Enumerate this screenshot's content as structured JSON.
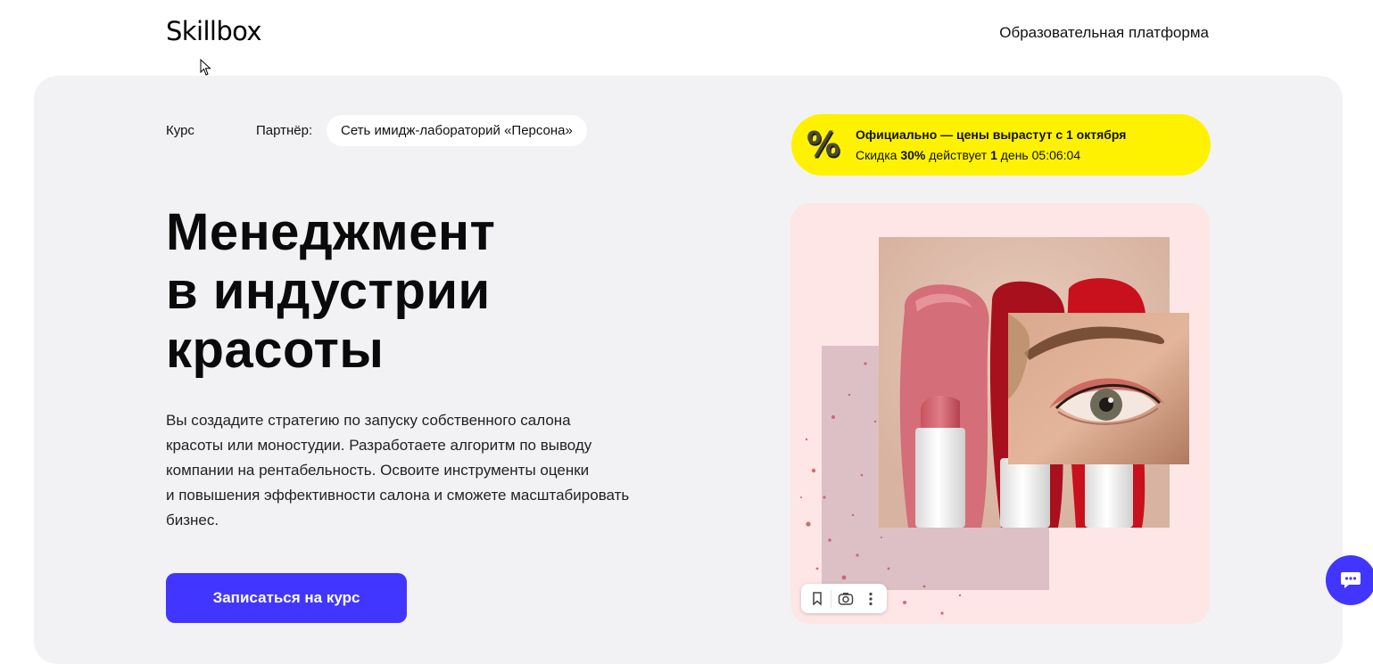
{
  "header": {
    "logo": "Skillbox",
    "tagline": "Образовательная платформа"
  },
  "meta": {
    "type_label": "Курс",
    "partner_label": "Партнёр:",
    "partner_name": "Сеть имидж-лабораторий «Персона»"
  },
  "promo": {
    "icon": "%",
    "line1": "Официально — цены вырастут с 1 октября",
    "line2_prefix": "Скидка",
    "discount": "30%",
    "line2_mid": "действует",
    "days": "1",
    "days_label": "день",
    "timer": "05:06:04",
    "color": "#fff200"
  },
  "course": {
    "title_lines": [
      "Менеджмент",
      "в индустрии",
      "красоты"
    ],
    "description_lines": [
      "Вы создадите стратегию по запуску собственного салона",
      "красоты или моностудии. Разработаете алгоритм по выводу",
      "компании на рентабельность. Освоите инструменты оценки",
      "и повышения эффективности салона и сможете масштабировать",
      "бизнес."
    ],
    "cta_label": "Записаться на курс"
  },
  "visual": {
    "description": "",
    "toolbar_icons": [
      "bookmark-icon",
      "lens-icon",
      "more-vertical-icon"
    ]
  },
  "colors": {
    "accent": "#4136ff",
    "hero_bg": "#f2f2f5",
    "visual_bg": "#fde6e5"
  },
  "icons": {
    "chat": "chat-bubble-icon",
    "cursor": "mouse-cursor-icon"
  }
}
